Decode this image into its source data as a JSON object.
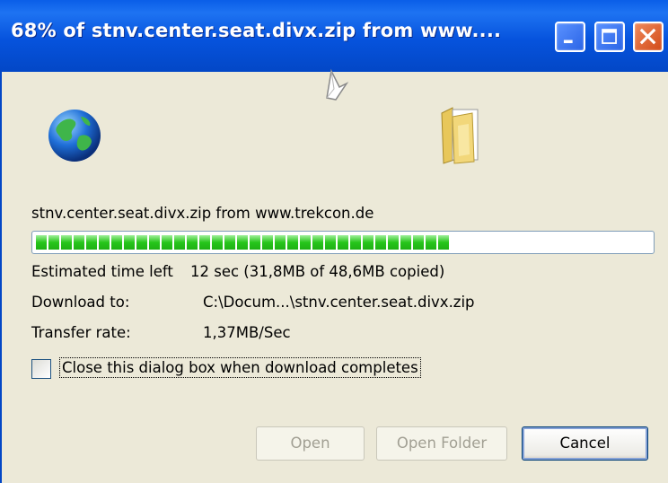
{
  "window": {
    "title": "68% of stnv.center.seat.divx.zip from www....",
    "controls": [
      "minimize",
      "maximize",
      "close"
    ]
  },
  "animation": {
    "source_icon": "globe-icon",
    "target_icon": "folder-icon",
    "moving_icon": "flying-paper-icon"
  },
  "download": {
    "file_line": "stnv.center.seat.divx.zip from www.trekcon.de",
    "progress_percent": 68,
    "progress_color": "#27c51b",
    "estimated_label": "Estimated time left",
    "estimated_value": "12 sec (31,8MB of 48,6MB copied)",
    "download_to_label": "Download to:",
    "download_to_value": "C:\\Docum...\\stnv.center.seat.divx.zip",
    "rate_label": "Transfer rate:",
    "rate_value": "1,37MB/Sec"
  },
  "options": {
    "close_on_complete_label": "Close this dialog box when download completes",
    "close_on_complete_checked": false
  },
  "buttons": {
    "open": "Open",
    "open_folder": "Open Folder",
    "cancel": "Cancel"
  }
}
